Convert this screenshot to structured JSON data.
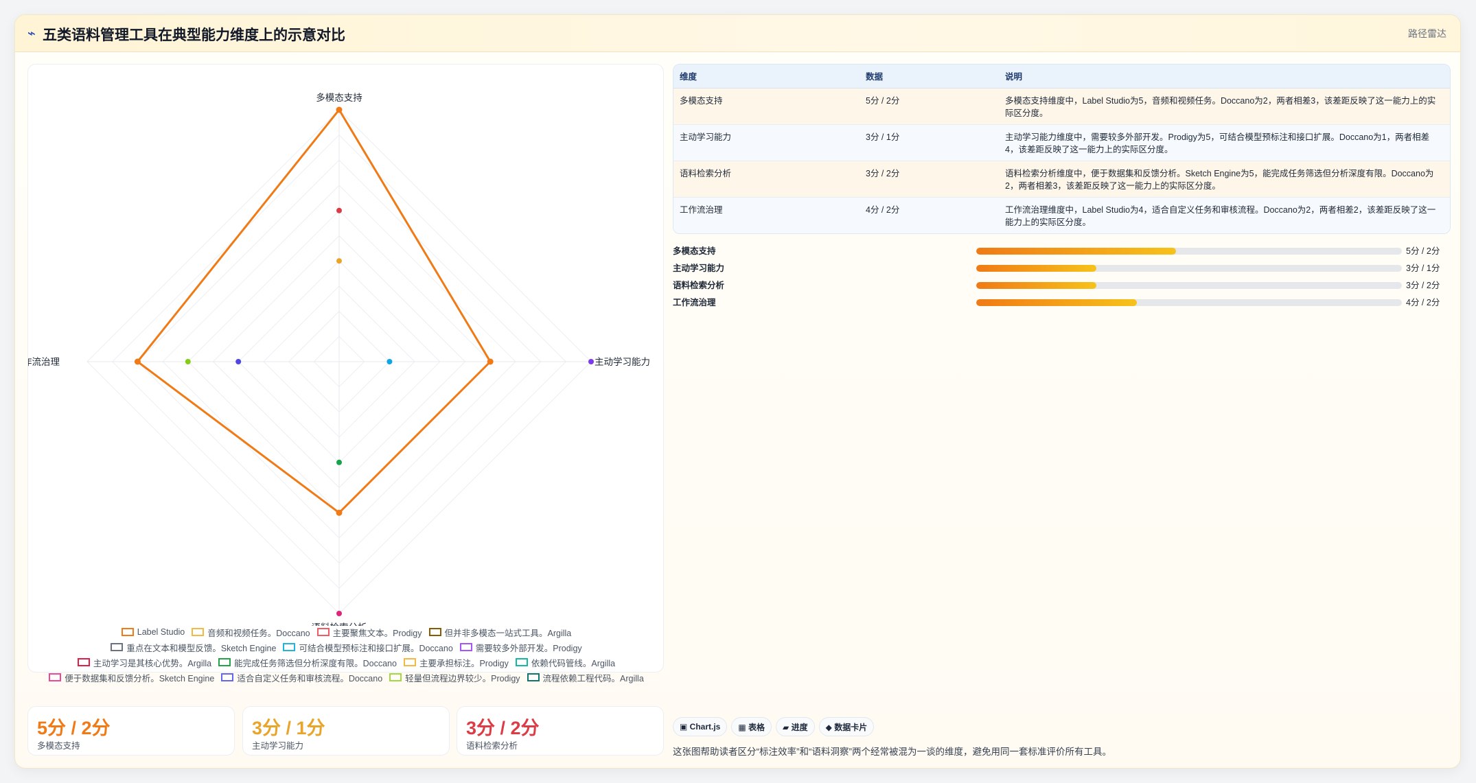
{
  "header": {
    "logo_icon": "lightning-icon",
    "logo_glyph": "⌁",
    "title": "五类语料管理工具在典型能力维度上的示意对比",
    "tag": "路径雷达"
  },
  "chart_data": {
    "type": "radar",
    "title": "",
    "axes": [
      "多模态支持",
      "主动学习能力",
      "语料检索分析",
      "工作流治理"
    ],
    "rmax": 5,
    "grid_levels": 10,
    "grid": true,
    "legend_position": "bottom",
    "series": [
      {
        "name": "Label Studio",
        "values": [
          5,
          3,
          3,
          4
        ],
        "color": "#f07a16",
        "shape": "polygon"
      }
    ],
    "points": [
      {
        "axis": "多模态支持",
        "value": 3.0,
        "color": "#dc3c46"
      },
      {
        "axis": "多模态支持",
        "value": 2.0,
        "color": "#e9a52a"
      },
      {
        "axis": "主动学习能力",
        "value": 5.0,
        "color": "#7c3aed"
      },
      {
        "axis": "主动学习能力",
        "value": 1.0,
        "color": "#0ea5e9"
      },
      {
        "axis": "语料检索分析",
        "value": 5.0,
        "color": "#db2777"
      },
      {
        "axis": "语料检索分析",
        "value": 2.0,
        "color": "#16a34a"
      },
      {
        "axis": "工作流治理",
        "value": 3.0,
        "color": "#84cc16"
      },
      {
        "axis": "工作流治理",
        "value": 2.0,
        "color": "#4f46e5"
      }
    ],
    "legend": [
      {
        "label": "Label Studio",
        "color": "#f07a16"
      },
      {
        "label": "音频和视频任务。Doccano",
        "color": "#f5b942"
      },
      {
        "label": "主要聚焦文本。Prodigy",
        "color": "#ef5b66"
      },
      {
        "label": "但并非多模态一站式工具。Argilla",
        "color": "#8a5a00"
      },
      {
        "label": "重点在文本和模型反馈。Sketch Engine",
        "color": "#6b7280"
      },
      {
        "label": "可结合模型预标注和接口扩展。Doccano",
        "color": "#22b5dc"
      },
      {
        "label": "需要较多外部开发。Prodigy",
        "color": "#a855f7"
      },
      {
        "label": "主动学习是其核心优势。Argilla",
        "color": "#e11d48"
      },
      {
        "label": "能完成任务筛选但分析深度有限。Doccano",
        "color": "#22a34a"
      },
      {
        "label": "主要承担标注。Prodigy",
        "color": "#f5b942"
      },
      {
        "label": "依赖代码管线。Argilla",
        "color": "#14b8a6"
      },
      {
        "label": "便于数据集和反馈分析。Sketch Engine",
        "color": "#ec4899"
      },
      {
        "label": "适合自定义任务和审核流程。Doccano",
        "color": "#6366f1"
      },
      {
        "label": "轻量但流程边界较少。Prodigy",
        "color": "#a3d940"
      },
      {
        "label": "流程依赖工程代码。Argilla",
        "color": "#0f766e"
      }
    ]
  },
  "kpis": [
    {
      "value": "5分 / 2分",
      "label": "多模态支持",
      "color": "#f07a16"
    },
    {
      "value": "3分 / 1分",
      "label": "主动学习能力",
      "color": "#e9a52a"
    },
    {
      "value": "3分 / 2分",
      "label": "语料检索分析",
      "color": "#dc3c46"
    }
  ],
  "table": {
    "headers": [
      "维度",
      "数据",
      "说明"
    ],
    "rows": [
      {
        "dim": "多模态支持",
        "data": "5分 / 2分",
        "desc": "多模态支持维度中，Label Studio为5，音频和视频任务。Doccano为2，两者相差3，该差距反映了这一能力上的实际区分度。"
      },
      {
        "dim": "主动学习能力",
        "data": "3分 / 1分",
        "desc": "主动学习能力维度中，需要较多外部开发。Prodigy为5，可结合模型预标注和接口扩展。Doccano为1，两者相差4，该差距反映了这一能力上的实际区分度。"
      },
      {
        "dim": "语料检索分析",
        "data": "3分 / 2分",
        "desc": "语料检索分析维度中，便于数据集和反馈分析。Sketch Engine为5，能完成任务筛选但分析深度有限。Doccano为2，两者相差3，该差距反映了这一能力上的实际区分度。"
      },
      {
        "dim": "工作流治理",
        "data": "4分 / 2分",
        "desc": "工作流治理维度中，Label Studio为4，适合自定义任务和审核流程。Doccano为2，两者相差2，该差距反映了这一能力上的实际区分度。"
      }
    ]
  },
  "bars": [
    {
      "label": "多模态支持",
      "value": "5分 / 2分",
      "fraction": 0.47
    },
    {
      "label": "主动学习能力",
      "value": "3分 / 1分",
      "fraction": 0.283
    },
    {
      "label": "语料检索分析",
      "value": "3分 / 2分",
      "fraction": 0.283
    },
    {
      "label": "工作流治理",
      "value": "4分 / 2分",
      "fraction": 0.377
    }
  ],
  "pills": [
    {
      "icon": "chart-icon",
      "label": "▣ Chart.js"
    },
    {
      "icon": "table-icon",
      "label": "▦ 表格"
    },
    {
      "icon": "progress-icon",
      "label": "▰ 进度"
    },
    {
      "icon": "card-icon",
      "label": "◆ 数据卡片"
    }
  ],
  "footnote": "这张图帮助读者区分“标注效率”和“语料洞察”两个经常被混为一谈的维度，避免用同一套标准评价所有工具。"
}
